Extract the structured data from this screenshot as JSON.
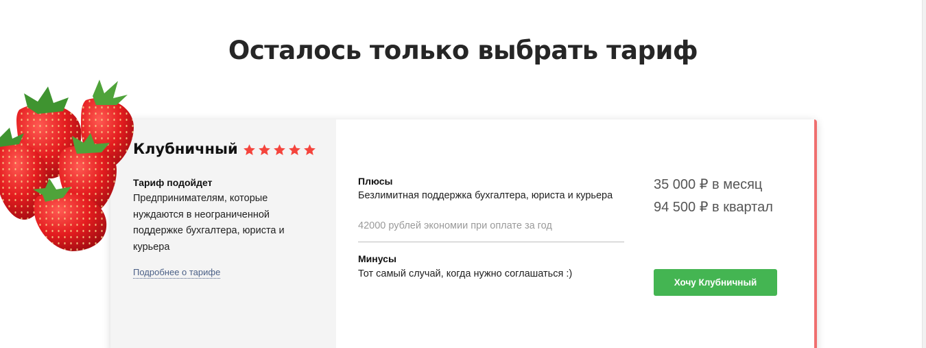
{
  "section": {
    "title": "Осталось только выбрать тариф"
  },
  "plan": {
    "name": "Клубничный",
    "rating": 5,
    "rating_max": 5,
    "star_color": "#f4443c",
    "suits_heading": "Тариф подойдет",
    "suits_text": "Предпринимателям, которые нуждаются в неограниченной поддержке бухгалтера, юриста и курьера",
    "more_link": "Подробнее о тарифе",
    "pros_heading": "Плюсы",
    "pros_text": "Безлимитная поддержка бухгалтера, юриста и курьера",
    "pros_note": "42000 рублей экономии при оплате за год",
    "cons_heading": "Минусы",
    "cons_text": "Тот самый случай, когда нужно соглашаться :)",
    "price_month": "35 000 ₽ в месяц",
    "price_quarter": "94 500 ₽ в квартал",
    "buy_button": "Хочу Клубничный",
    "button_color": "#44b552",
    "accent_color": "#ef6f6f"
  },
  "images": {
    "berries": "strawberries-photo"
  }
}
